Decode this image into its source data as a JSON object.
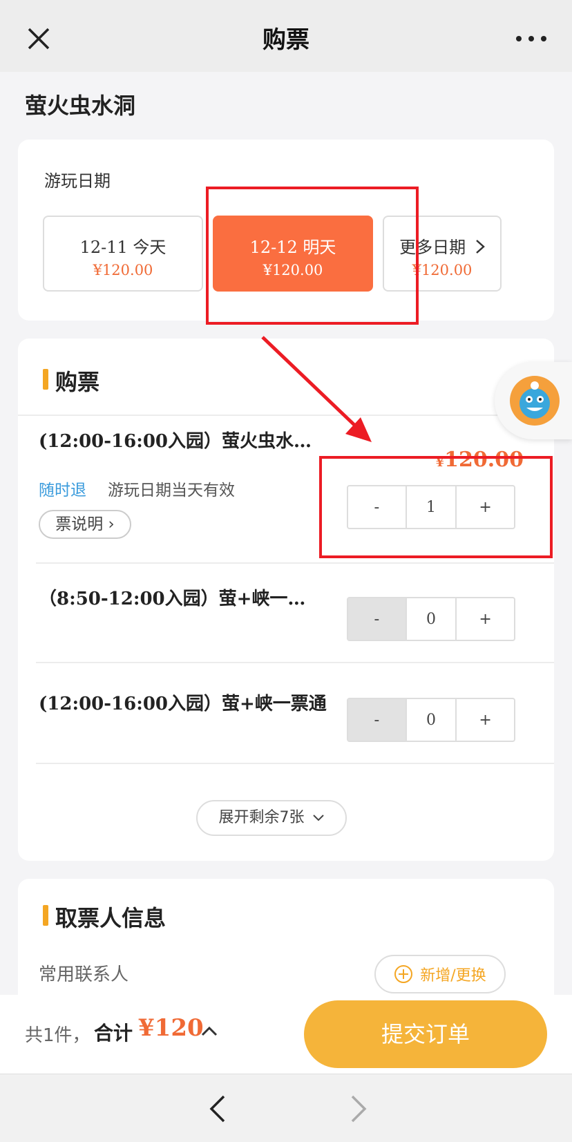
{
  "header": {
    "title": "购票"
  },
  "scenic_name": "萤火虫水洞",
  "date_section": {
    "label": "游玩日期",
    "options": [
      {
        "date": "12-11  今天",
        "price": "¥120.00",
        "selected": false
      },
      {
        "date": "12-12  明天",
        "price": "¥120.00",
        "selected": true
      },
      {
        "date": "更多日期",
        "price": "¥120.00",
        "selected": false
      }
    ]
  },
  "tickets_section": {
    "title": "购票",
    "tickets": [
      {
        "name": "(12:00-16:00入园）萤火虫水…",
        "refund": "随时退",
        "validity": "游玩日期当天有效",
        "explain": "票说明",
        "price_symbol": "¥",
        "price": "120.00",
        "qty": "1",
        "minus": "-",
        "plus": "+"
      },
      {
        "name": "（8:50-12:00入园）萤+峡一…",
        "qty": "0",
        "minus": "-",
        "plus": "+"
      },
      {
        "name": "(12:00-16:00入园）萤+峡一票通",
        "qty": "0",
        "minus": "-",
        "plus": "+"
      }
    ],
    "expand": "展开剩余7张"
  },
  "contact_section": {
    "title": "取票人信息",
    "label": "常用联系人",
    "add_button": "新增/更换"
  },
  "bottom_bar": {
    "count": "共1件，",
    "total_label": "合计",
    "total_value": "¥120",
    "submit": "提交订单"
  },
  "colors": {
    "accent": "#fa6e40",
    "price": "#f06a35",
    "submit": "#f5b43a",
    "refund": "#3a9bdc",
    "annotation": "#ec1c24"
  }
}
